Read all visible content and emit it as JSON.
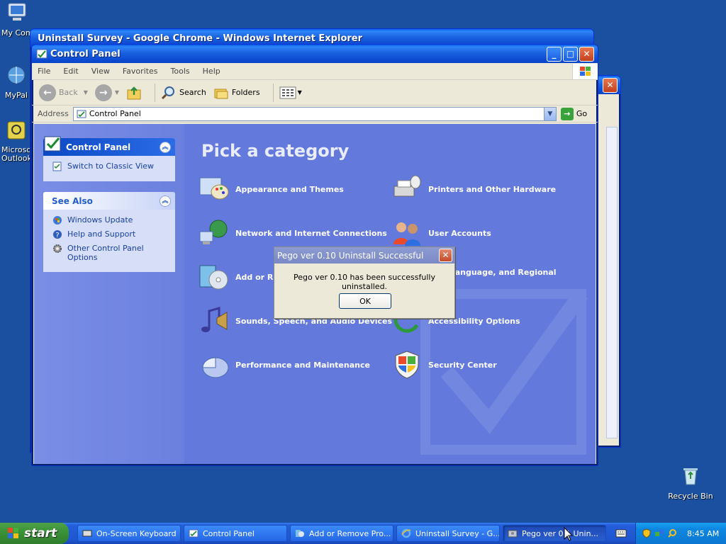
{
  "desktop": {
    "icons": [
      {
        "label": "My Computer"
      },
      {
        "label": "MyPal"
      },
      {
        "label": "Microsoft Outlook"
      },
      {
        "label": "Recycle Bin"
      }
    ]
  },
  "ie_window": {
    "title": "Uninstall Survey - Google Chrome - Windows Internet Explorer"
  },
  "control_panel": {
    "title": "Control Panel",
    "menu": [
      "File",
      "Edit",
      "View",
      "Favorites",
      "Tools",
      "Help"
    ],
    "toolbar": {
      "back": "Back",
      "search": "Search",
      "folders": "Folders"
    },
    "address": {
      "label": "Address",
      "value": "Control Panel",
      "go": "Go"
    },
    "sidebar": {
      "panel_title": "Control Panel",
      "switch_view": "Switch to Classic View",
      "see_also_title": "See Also",
      "see_also": [
        "Windows Update",
        "Help and Support",
        "Other Control Panel Options"
      ]
    },
    "heading": "Pick a category",
    "categories": [
      "Appearance and Themes",
      "Printers and Other Hardware",
      "Network and Internet Connections",
      "User Accounts",
      "Add or Re",
      "ime, Language, and Regional",
      "Sounds, Speech, and Audio Devices",
      "Accessibility Options",
      "Performance and Maintenance",
      "Security Center"
    ]
  },
  "dialog": {
    "title": "Pego ver 0.10 Uninstall Successful",
    "message": "Pego ver 0.10 has been successfully uninstalled.",
    "ok": "OK"
  },
  "taskbar": {
    "start": "start",
    "tasks": [
      "On-Screen Keyboard",
      "Control Panel",
      "Add or Remove Pro...",
      "Uninstall Survey - G...",
      "Pego ver 0.1 Unin..."
    ],
    "clock": "8:45 AM"
  },
  "colors": {
    "desktop": "#1b4fa0",
    "cp_main": "#6479dc",
    "xp_blue": "#0a5ee6",
    "start_green": "#3c9338"
  }
}
